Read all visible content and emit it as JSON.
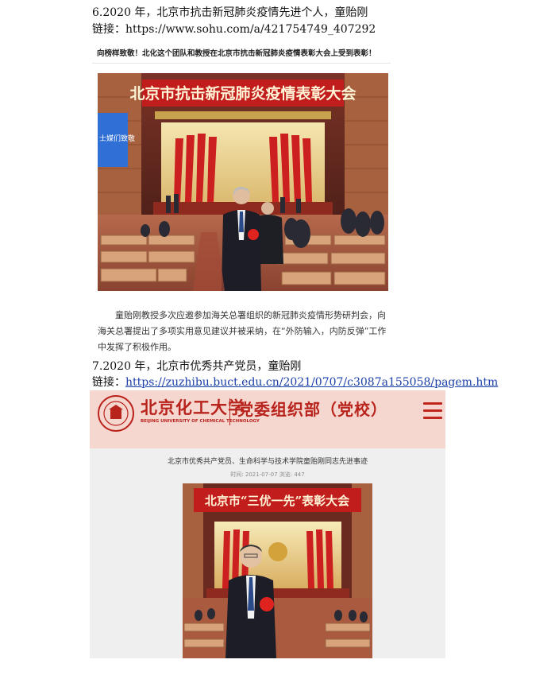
{
  "section6": {
    "heading": "6.2020 年，北京市抗击新冠肺炎疫情先进个人，童贻刚",
    "link_prefix": "链接：",
    "link_url": "https://www.sohu.com/a/421754749_407292",
    "banner_text": "向榜样致敬！北化这个团队和教授在北京市抗击新冠肺炎疫情表彰大会上受到表彰！",
    "photo_banner": "北京市抗击新冠肺炎疫情表彰大会",
    "screen_text": "士媒们致敬",
    "paragraph": "童贻刚教授多次应邀参加海关总署组织的新冠肺炎疫情形势研判会，向海关总署提出了多项实用意见建议并被采纳，在“外防输入，内防反弹”工作中发挥了积极作用。"
  },
  "section7": {
    "heading": "7.2020 年，北京市优秀共产党员，童贻刚",
    "link_prefix": "链接：",
    "link_url": "https://zuzhibu.buct.edu.cn/2021/0707/c3087a155058/pagem.htm",
    "site": {
      "logo_cn": "北京化工大学",
      "logo_en": "BEIJING UNIVERSITY OF CHEMICAL TECHNOLOGY",
      "dept": "党委组织部（党校）",
      "article_title": "北京市优秀共产党员、生命科学与技术学院童贻刚同志先进事迹",
      "article_meta": "时间: 2021-07-07  浏览: 447",
      "photo_banner": "北京市“三优一先”表彰大会"
    }
  },
  "colors": {
    "accent_red": "#b8231c",
    "link_blue": "#1a3fa8",
    "header_pink": "#f6d7d0"
  }
}
